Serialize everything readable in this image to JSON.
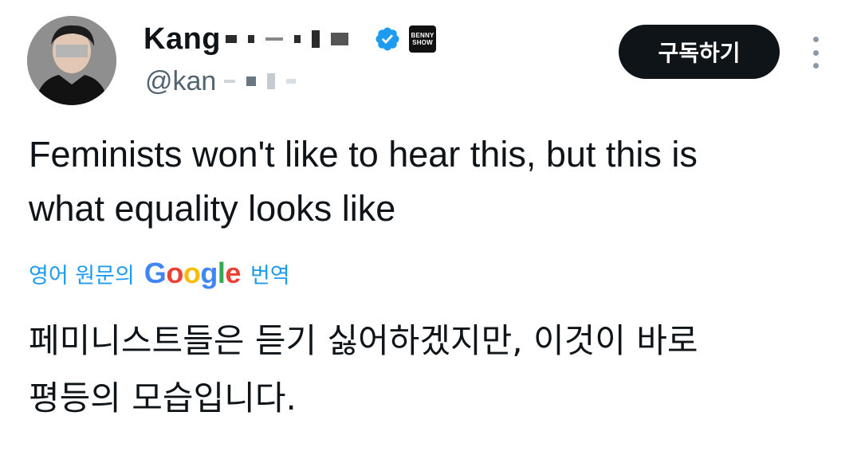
{
  "header": {
    "display_name": "Kang",
    "handle": "@kan",
    "subscribe_label": "구독하기",
    "affiliate_badge": [
      "BENNY",
      "SHOW"
    ]
  },
  "tweet": {
    "text_lines": [
      "Feminists won't like to hear this, but this is",
      "what equality looks like"
    ]
  },
  "translation": {
    "label": "영어 원문의",
    "provider": "Google",
    "suffix": "번역",
    "text_lines": [
      "페미니스트들은 듣기 싫어하겠지만, 이것이 바로",
      "평등의 모습입니다."
    ]
  },
  "icons": {
    "verified": "verified-badge-icon",
    "more": "more-vertical-icon"
  },
  "colors": {
    "accent": "#1d9bf0",
    "subscribe_bg": "#0f1419",
    "text": "#0f1419",
    "secondary": "#536471"
  }
}
